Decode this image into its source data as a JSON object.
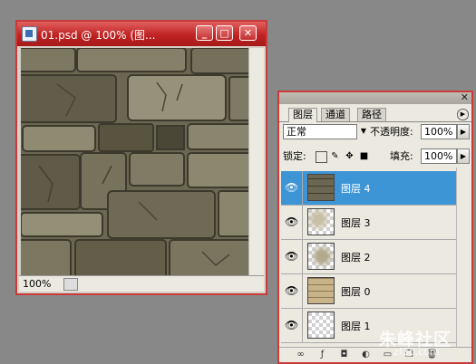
{
  "document_window": {
    "title": "01.psd @ 100% (图...",
    "buttons": {
      "minimize": "_",
      "maximize": "□",
      "close": "✕"
    },
    "zoom": "100%",
    "file_icon": "psd-file-icon"
  },
  "layers_panel": {
    "tabs": [
      {
        "label": "图层"
      },
      {
        "label": "通道"
      },
      {
        "label": "路径"
      }
    ],
    "close": "✕",
    "blend_mode": "正常",
    "opacity_label": "不透明度:",
    "opacity_value": "100%",
    "lock_label": "锁定:",
    "fill_label": "填充:",
    "fill_value": "100%",
    "layers": [
      {
        "name": "图层 4",
        "selected": true,
        "thumb": "stone-wall"
      },
      {
        "name": "图层 3",
        "selected": false,
        "thumb": "light-stone-transparent"
      },
      {
        "name": "图层 2",
        "selected": false,
        "thumb": "light-stone-transparent"
      },
      {
        "name": "图层 0",
        "selected": false,
        "thumb": "tan-bricks"
      },
      {
        "name": "图层 1",
        "selected": false,
        "thumb": "transparent"
      }
    ]
  },
  "watermark": {
    "text": "朱峰社区",
    "url": "zf3d.com"
  },
  "colors": {
    "window_border": "#c93a3a",
    "selection": "#3d95d6",
    "background": "#888888"
  }
}
